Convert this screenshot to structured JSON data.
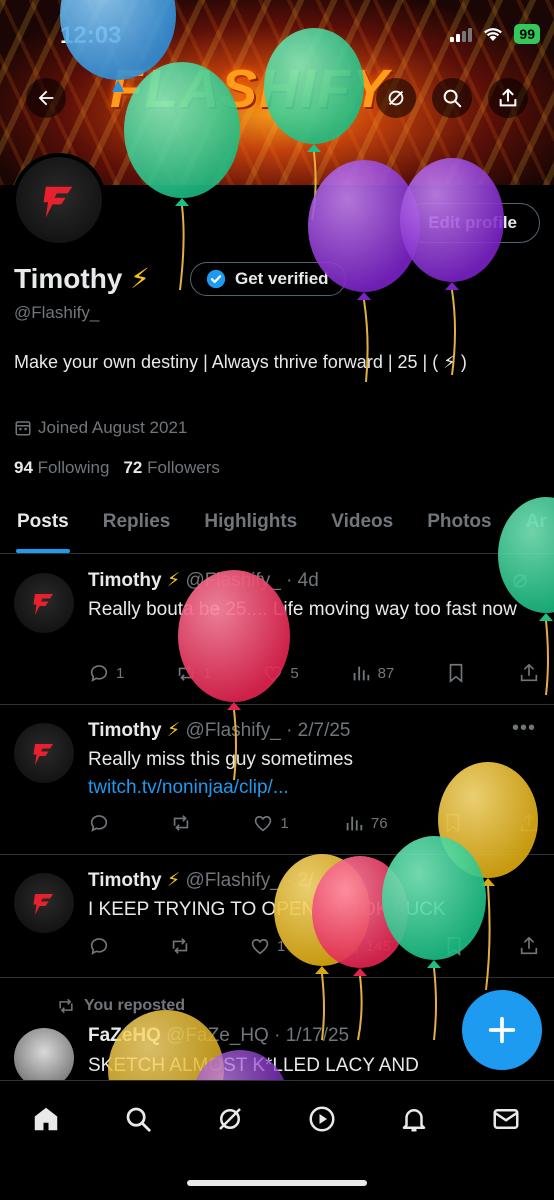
{
  "status_bar": {
    "time": "12:03",
    "battery": "99"
  },
  "header": {
    "banner_text": "FLASHIFY"
  },
  "profile": {
    "edit_label": "Edit profile",
    "name": "Timothy",
    "name_emoji": "⚡",
    "verify_label": "Get verified",
    "handle": "@Flashify_",
    "bio": "Make your own destiny | Always thrive forward | 25 | ( ⚡ )",
    "joined": "Joined August 2021",
    "following_count": "94",
    "following_label": "Following",
    "followers_count": "72",
    "followers_label": "Followers"
  },
  "tabs": [
    "Posts",
    "Replies",
    "Highlights",
    "Videos",
    "Photos",
    "Ar"
  ],
  "posts": [
    {
      "name": "Timothy",
      "emoji": "⚡",
      "handle": "@Flashify_",
      "date": "· 4d",
      "text": "Really bouta be 25.... Life moving way too fast now",
      "link": "",
      "replies": "1",
      "reposts": "1",
      "likes": "5",
      "views": "87"
    },
    {
      "name": "Timothy",
      "emoji": "⚡",
      "handle": "@Flashify_",
      "date": "· 2/7/25",
      "text": "Really miss this guy sometimes",
      "link": "twitch.tv/noninjaa/clip/...",
      "replies": "",
      "reposts": "",
      "likes": "1",
      "views": "76"
    },
    {
      "name": "Timothy",
      "emoji": "⚡",
      "handle": "@Flashify_",
      "date": "· 2/",
      "text": "I KEEP TRYING TO OPEN TIKTOK FUCK",
      "link": "",
      "replies": "",
      "reposts": "",
      "likes": "1",
      "views": "145"
    }
  ],
  "repost": {
    "label": "You reposted",
    "name": "FaZeHQ",
    "handle": "@FaZe_HQ",
    "date": "· 1/17/25",
    "text": "SKETCH ALMOST K*LLED LACY AND"
  },
  "colors": {
    "accent": "#1d9bf0",
    "secondary_text": "#71767b",
    "bolt": "#f5c518",
    "battery": "#34c759"
  },
  "icons": [
    "back-arrow-icon",
    "grok-icon",
    "search-icon",
    "share-icon",
    "verified-badge-icon",
    "calendar-icon",
    "reply-icon",
    "repost-icon",
    "like-icon",
    "views-icon",
    "bookmark-icon",
    "more-icon",
    "compose-icon",
    "home-icon",
    "explore-icon",
    "video-icon",
    "notifications-icon",
    "messages-icon"
  ]
}
